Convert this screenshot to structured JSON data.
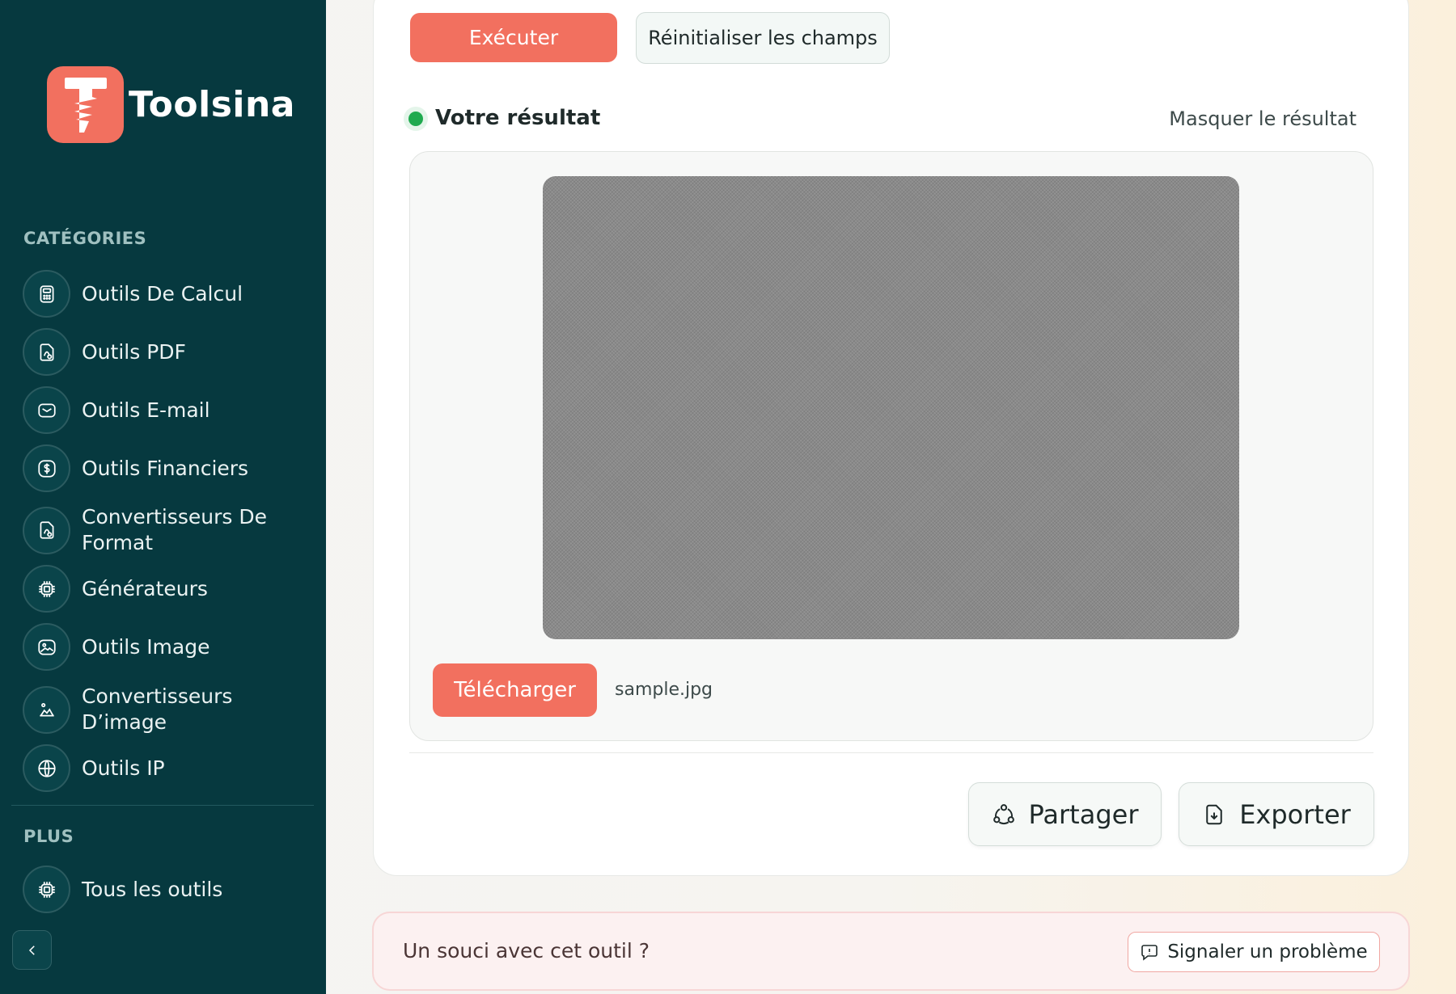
{
  "brand": {
    "name": "Toolsina",
    "accent": "#f2705f",
    "sidebar_bg": "#06393f"
  },
  "sidebar": {
    "categories_label": "CATÉGORIES",
    "items": [
      {
        "label": "Outils De Calcul",
        "icon": "calculator-icon"
      },
      {
        "label": "Outils PDF",
        "icon": "pdf-file-icon"
      },
      {
        "label": "Outils E-mail",
        "icon": "mail-icon"
      },
      {
        "label": "Outils Financiers",
        "icon": "dollar-icon"
      },
      {
        "label": "Convertisseurs De Format",
        "icon": "file-convert-icon"
      },
      {
        "label": "Générateurs",
        "icon": "chip-icon"
      },
      {
        "label": "Outils Image",
        "icon": "image-icon"
      },
      {
        "label": "Convertisseurs D’image",
        "icon": "image-convert-icon"
      },
      {
        "label": "Outils IP",
        "icon": "globe-icon"
      }
    ],
    "more_label": "PLUS",
    "more_items": [
      {
        "label": "Tous les outils",
        "icon": "chip-icon"
      }
    ]
  },
  "actions": {
    "run_label": "Exécuter",
    "reset_label": "Réinitialiser les champs"
  },
  "result": {
    "title": "Votre résultat",
    "hide_label": "Masquer le résultat",
    "download_label": "Télécharger",
    "filename": "sample.jpg",
    "status_color": "#1faa4f"
  },
  "share": {
    "share_label": "Partager",
    "export_label": "Exporter"
  },
  "issue": {
    "text": "Un souci avec cet outil ?",
    "report_label": "Signaler un problème"
  }
}
